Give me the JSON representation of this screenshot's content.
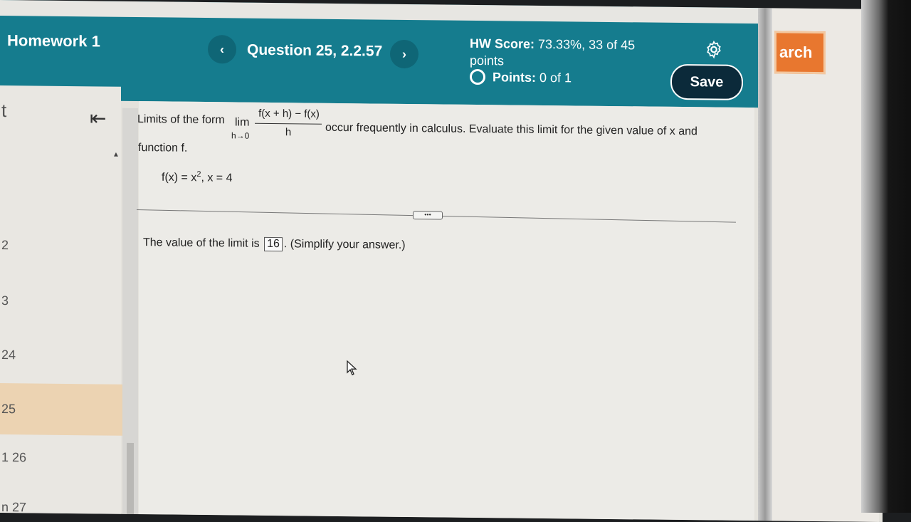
{
  "header": {
    "title": "Homework 1",
    "question_label": "Question 25, 2.2.57",
    "prev_icon": "‹",
    "next_icon": "›",
    "score_label": "HW Score:",
    "score_value": "73.33%, 33 of 45",
    "score_suffix": "points",
    "points_label": "Points:",
    "points_value": "0 of 1",
    "save_label": "Save",
    "settings_icon": "gear-icon"
  },
  "side_window": {
    "search_partial": "arch"
  },
  "sidebar": {
    "items": [
      {
        "label": "t"
      },
      {
        "label": "2"
      },
      {
        "label": "3"
      },
      {
        "label": "24"
      },
      {
        "label": "25",
        "active": true
      },
      {
        "label": "26"
      },
      {
        "label": "27"
      }
    ],
    "item_prefix_26": "1",
    "item_prefix_27": "n"
  },
  "problem": {
    "intro": "Limits of the form",
    "lim": "lim",
    "lim_sub": "h→0",
    "numerator": "f(x + h) − f(x)",
    "denominator": "h",
    "rest": "occur frequently in calculus. Evaluate this limit for the given value of x and",
    "rest2": "function f.",
    "function_def": "f(x) = x",
    "exponent": "2",
    "given_x": ",   x = 4",
    "ellipsis": "•••",
    "answer_prefix": "The value of the limit is",
    "answer_value": "16",
    "answer_suffix": ". (Simplify your answer.)"
  },
  "colors": {
    "header_bg": "#157c8e",
    "save_bg": "#0b2a3a",
    "active_item_bg": "#ecd3b2",
    "search_btn_bg": "#e8772f"
  }
}
